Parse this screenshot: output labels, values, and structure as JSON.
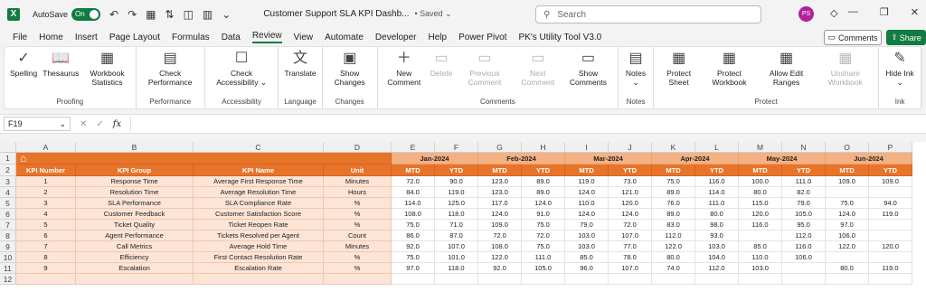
{
  "titlebar": {
    "app_icon": "X",
    "autosave_label": "AutoSave",
    "autosave_state": "On",
    "doc_title": "Customer Support SLA KPI Dashb...",
    "saved_label": "• Saved ⌄",
    "search_placeholder": "Search",
    "user_initials": "PS"
  },
  "menu": {
    "tabs": [
      "File",
      "Home",
      "Insert",
      "Page Layout",
      "Formulas",
      "Data",
      "Review",
      "View",
      "Automate",
      "Developer",
      "Help",
      "Power Pivot",
      "PK's Utility Tool V3.0"
    ],
    "active": "Review",
    "comments_label": "Comments",
    "share_label": "Share"
  },
  "ribbon": {
    "groups": [
      {
        "name": "Proofing",
        "buttons": [
          {
            "label": "Spelling",
            "icon": "abc-check-icon"
          },
          {
            "label": "Thesaurus",
            "icon": "book-icon"
          },
          {
            "label": "Workbook Statistics",
            "icon": "statistics-icon"
          }
        ]
      },
      {
        "name": "Performance",
        "buttons": [
          {
            "label": "Check Performance",
            "icon": "performance-icon"
          }
        ]
      },
      {
        "name": "Accessibility",
        "buttons": [
          {
            "label": "Check Accessibility ⌄",
            "icon": "accessibility-icon"
          }
        ]
      },
      {
        "name": "Language",
        "buttons": [
          {
            "label": "Translate",
            "icon": "translate-icon"
          }
        ]
      },
      {
        "name": "Changes",
        "buttons": [
          {
            "label": "Show Changes",
            "icon": "changes-icon"
          }
        ]
      },
      {
        "name": "Comments",
        "buttons": [
          {
            "label": "New Comment",
            "icon": "new-comment-icon"
          },
          {
            "label": "Delete",
            "icon": "delete-comment-icon",
            "disabled": true
          },
          {
            "label": "Previous Comment",
            "icon": "previous-comment-icon",
            "disabled": true
          },
          {
            "label": "Next Comment",
            "icon": "next-comment-icon",
            "disabled": true
          },
          {
            "label": "Show Comments",
            "icon": "show-comments-icon"
          }
        ]
      },
      {
        "name": "Notes",
        "buttons": [
          {
            "label": "Notes ⌄",
            "icon": "notes-icon"
          }
        ]
      },
      {
        "name": "Protect",
        "buttons": [
          {
            "label": "Protect Sheet",
            "icon": "protect-sheet-icon"
          },
          {
            "label": "Protect Workbook",
            "icon": "protect-workbook-icon"
          },
          {
            "label": "Allow Edit Ranges",
            "icon": "allow-edit-icon"
          },
          {
            "label": "Unshare Workbook",
            "icon": "unshare-icon",
            "disabled": true
          }
        ]
      },
      {
        "name": "Ink",
        "buttons": [
          {
            "label": "Hide Ink ⌄",
            "icon": "ink-icon"
          }
        ]
      }
    ]
  },
  "formula_bar": {
    "name_box": "F19",
    "fx": "fx"
  },
  "sheet": {
    "columns": [
      "A",
      "B",
      "C",
      "D",
      "E",
      "F",
      "G",
      "H",
      "I",
      "J",
      "K",
      "L",
      "M",
      "N",
      "O",
      "P"
    ],
    "rows": [
      "1",
      "2",
      "3",
      "4",
      "5",
      "6",
      "7",
      "8",
      "9",
      "10",
      "11",
      "12"
    ],
    "headers": [
      "KPI Number",
      "KPI Group",
      "KPI Name",
      "Unit"
    ],
    "months": [
      "Jan-2024",
      "Feb-2024",
      "Mar-2024",
      "Apr-2024",
      "May-2024",
      "Jun-2024"
    ],
    "sub_headers": [
      "MTD",
      "YTD"
    ],
    "data": [
      [
        "1",
        "Response Time",
        "Average First Response Time",
        "Minutes",
        "72.0",
        "90.0",
        "123.0",
        "89.0",
        "119.0",
        "73.0",
        "75.0",
        "116.0",
        "100.0",
        "111.0",
        "109.0",
        "109.0"
      ],
      [
        "2",
        "Resolution Time",
        "Average Resolution Time",
        "Hours",
        "84.0",
        "119.0",
        "123.0",
        "89.0",
        "124.0",
        "121.0",
        "89.0",
        "114.0",
        "80.0",
        "82.0",
        "",
        ""
      ],
      [
        "3",
        "SLA Performance",
        "SLA Compliance Rate",
        "%",
        "114.0",
        "125.0",
        "117.0",
        "124.0",
        "110.0",
        "120.0",
        "76.0",
        "111.0",
        "115.0",
        "79.0",
        "75.0",
        "94.0"
      ],
      [
        "4",
        "Customer Feedback",
        "Customer Satisfaction Score",
        "%",
        "108.0",
        "118.0",
        "124.0",
        "91.0",
        "124.0",
        "124.0",
        "89.0",
        "80.0",
        "120.0",
        "105.0",
        "124.0",
        "119.0"
      ],
      [
        "5",
        "Ticket Quality",
        "Ticket Reopen Rate",
        "%",
        "75.0",
        "71.0",
        "109.0",
        "75.0",
        "79.0",
        "72.0",
        "83.0",
        "98.0",
        "116.0",
        "95.0",
        "97.0",
        ""
      ],
      [
        "6",
        "Agent Performance",
        "Tickets Resolved per Agent",
        "Count",
        "86.0",
        "87.0",
        "72.0",
        "72.0",
        "103.0",
        "107.0",
        "112.0",
        "93.0",
        "",
        "112.0",
        "106.0",
        ""
      ],
      [
        "7",
        "Call Metrics",
        "Average Hold Time",
        "Minutes",
        "92.0",
        "107.0",
        "108.0",
        "75.0",
        "103.0",
        "77.0",
        "122.0",
        "103.0",
        "85.0",
        "116.0",
        "122.0",
        "120.0"
      ],
      [
        "8",
        "Efficiency",
        "First Contact Resolution Rate",
        "%",
        "75.0",
        "101.0",
        "122.0",
        "111.0",
        "85.0",
        "78.0",
        "80.0",
        "104.0",
        "110.0",
        "106.0",
        "",
        ""
      ],
      [
        "9",
        "Escalation",
        "Escalation Rate",
        "%",
        "97.0",
        "118.0",
        "92.0",
        "105.0",
        "96.0",
        "107.0",
        "74.0",
        "112.0",
        "103.0",
        "",
        "80.0",
        "119.0"
      ]
    ],
    "colors": {
      "header": "#e8742a",
      "month": "#f4b183",
      "data": "#fce4d6"
    }
  }
}
